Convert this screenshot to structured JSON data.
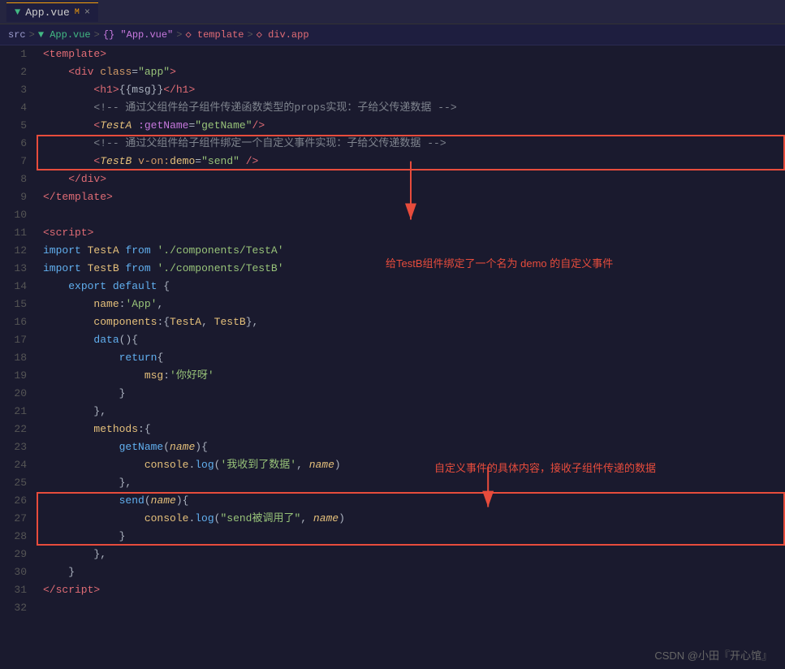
{
  "tab": {
    "filename": "App.vue",
    "modified": true,
    "close": "×"
  },
  "breadcrumb": {
    "src": "src",
    "app_vue": "App.vue",
    "obj": "{} \"App.vue\"",
    "template": "template",
    "div_app": "div.app"
  },
  "watermark": "CSDN @小田『开心馆』",
  "annotation1": "给TestB组件绑定了一个名为 demo 的自定义事件",
  "annotation2": "自定义事件的具体内容，接收子组件传递的数据"
}
